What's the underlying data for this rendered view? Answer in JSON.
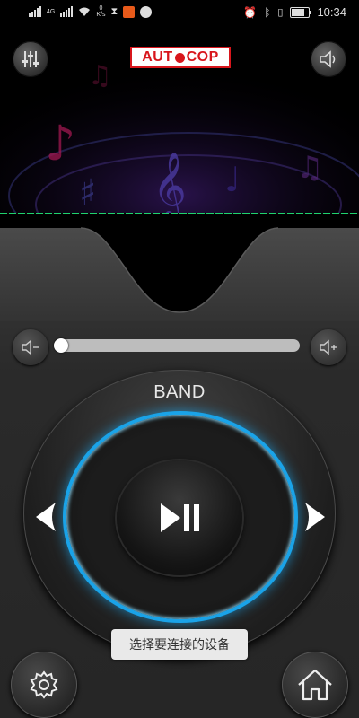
{
  "status_bar": {
    "network": "4G",
    "speed_value": "0",
    "speed_unit": "K/s",
    "time": "10:34",
    "battery_level": 0.8
  },
  "header": {
    "logo_text_left": "AUT",
    "logo_text_right": "COP",
    "eq_icon": "equalizer-icon",
    "speaker_icon": "speaker-icon"
  },
  "volume": {
    "down_icon": "volume-down-icon",
    "up_icon": "volume-up-icon",
    "level": 0.0
  },
  "dial": {
    "band_label": "BAND",
    "play_pause_icon": "play-pause-icon",
    "prev_icon": "chevron-left-icon",
    "next_icon": "chevron-right-icon",
    "ring_color": "#1aa3e8"
  },
  "toast": {
    "text": "选择要连接的设备"
  },
  "bottom": {
    "settings_icon": "gear-icon",
    "home_icon": "home-icon"
  },
  "colors": {
    "eq_bar": "#1fd36e",
    "logo_red": "#d8161c"
  }
}
